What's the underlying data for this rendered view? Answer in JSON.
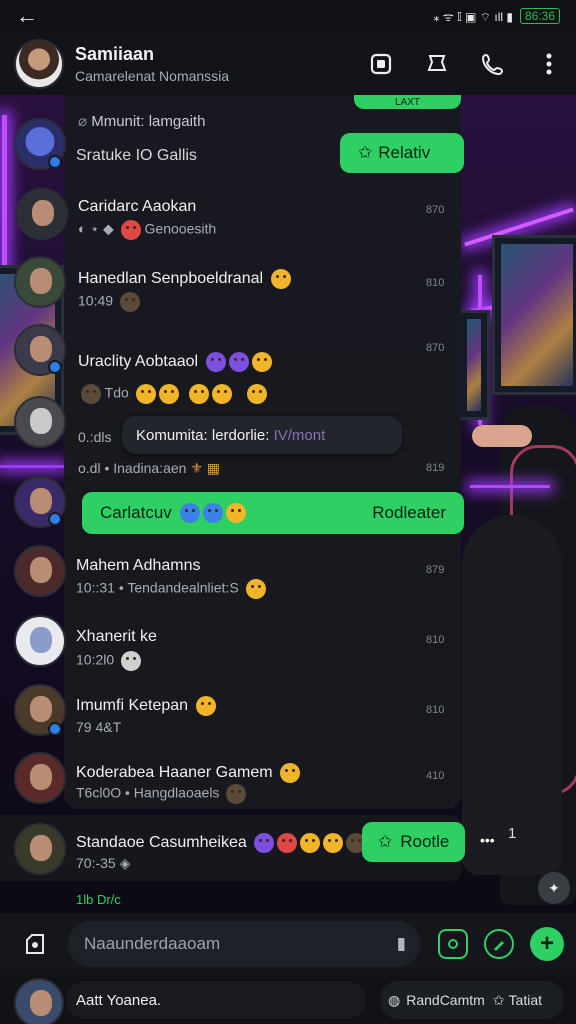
{
  "status_bar": {
    "right_text": "⁎ ᯤ 𝕀 ▣ ⌔ ıll ▮",
    "battery": "86:36"
  },
  "header": {
    "name": "Samiiaan",
    "subtitle": "Camarelenat Nomanssia"
  },
  "chats": [
    {
      "title": "Mmunit: lamgaith",
      "subtitle": "Sratuke IO Gallis",
      "time": ""
    },
    {
      "title": "Caridarc Aaokan",
      "subtitle": "Genooesith",
      "time": "870"
    },
    {
      "title": "Hanedlan Senpboeldranal",
      "subtitle": "10:49",
      "time": "810"
    },
    {
      "title": "Uraclity Aobtaaol",
      "subtitle": "Tdo",
      "time": "870"
    },
    {
      "title": "",
      "subtitle": "0.:dls",
      "time": ""
    },
    {
      "title": "",
      "subtitle": "o.dl • Inadina:aen",
      "time": "819"
    },
    {
      "title": "Mahem Adhamns",
      "subtitle": "10::31 • Tendandealnliet:S",
      "time": "879"
    },
    {
      "title": "Xhanerit ke",
      "subtitle": "10:2l0",
      "time": "810"
    },
    {
      "title": "Imumfi Ketepan",
      "subtitle": "79 4&T",
      "time": "810"
    },
    {
      "title": "Koderabea Haaner Gamem",
      "subtitle": "T6cl0O • Hangdlaoaels",
      "time": "410"
    },
    {
      "title": "Standaoe Casumheikea",
      "subtitle": "70:-35",
      "time": ""
    }
  ],
  "bubbles": {
    "top_partial": "LAXT",
    "relative": "Relativ",
    "tooltip": "Komumita: lerdorlie:",
    "tooltip_tail": "IV/mont",
    "green_left": "Carlatcuv",
    "green_right": "Rodleater",
    "rootle": "Rootle"
  },
  "side_counts": {
    "dots": "•••",
    "count": "1"
  },
  "footer_label": "1lb Dr/c",
  "input": {
    "placeholder": "Naaunderdaaoam"
  },
  "bottom": {
    "name": "Aatt Yoanea.",
    "chip1": "RandCamtm",
    "chip2": "Tatiat"
  }
}
